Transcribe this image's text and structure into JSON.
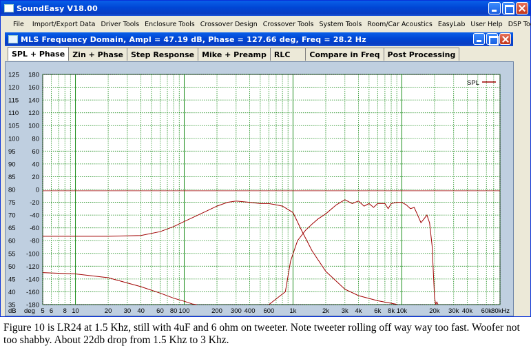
{
  "window": {
    "title": "SoundEasy V18.00"
  },
  "menu": [
    "File",
    "Import/Export Data",
    "Driver Tools",
    "Enclosure Tools",
    "Crossover Design",
    "Crossover Tools",
    "System Tools",
    "Room/Car Acoustics",
    "EasyLab",
    "User Help",
    "DSP Tools"
  ],
  "subwindow": {
    "title": "MLS Frequency Domain, Ampl = 47.19 dB, Phase = 127.66 deg, Freq = 28.2 Hz"
  },
  "tabs": [
    {
      "label": "SPL + Phase",
      "active": true
    },
    {
      "label": "Zin + Phase",
      "active": false
    },
    {
      "label": "Step Response",
      "active": false
    },
    {
      "label": "Mike + Preamp",
      "active": false
    },
    {
      "label": "RLC",
      "active": false
    },
    {
      "label": "Compare in Freq",
      "active": false
    },
    {
      "label": "Post Processing",
      "active": false
    }
  ],
  "chart_data": {
    "type": "line",
    "x_scale": "log",
    "xlim": [
      5,
      80000
    ],
    "x_ticks": [
      {
        "v": 5,
        "label": "5"
      },
      {
        "v": 6,
        "label": "6"
      },
      {
        "v": 8,
        "label": "8"
      },
      {
        "v": 10,
        "label": "10"
      },
      {
        "v": 20,
        "label": "20"
      },
      {
        "v": 30,
        "label": "30"
      },
      {
        "v": 40,
        "label": "40"
      },
      {
        "v": 60,
        "label": "60"
      },
      {
        "v": 80,
        "label": "80"
      },
      {
        "v": 100,
        "label": "100"
      },
      {
        "v": 200,
        "label": "200"
      },
      {
        "v": 300,
        "label": "300"
      },
      {
        "v": 400,
        "label": "400"
      },
      {
        "v": 600,
        "label": "600"
      },
      {
        "v": 1000,
        "label": "1k"
      },
      {
        "v": 2000,
        "label": "2k"
      },
      {
        "v": 3000,
        "label": "3k"
      },
      {
        "v": 4000,
        "label": "4k"
      },
      {
        "v": 6000,
        "label": "6k"
      },
      {
        "v": 8000,
        "label": "8k"
      },
      {
        "v": 10000,
        "label": "10k"
      },
      {
        "v": 20000,
        "label": "20k"
      },
      {
        "v": 30000,
        "label": "30k"
      },
      {
        "v": 40000,
        "label": "40k"
      },
      {
        "v": 60000,
        "label": "60k"
      },
      {
        "v": 80000,
        "label": "80kHz"
      }
    ],
    "x_unit_labels": [
      "dB",
      "deg"
    ],
    "ylim": [
      35,
      125
    ],
    "y_ticks": [
      125,
      120,
      115,
      110,
      105,
      100,
      95,
      90,
      85,
      80,
      75,
      70,
      65,
      60,
      55,
      50,
      45,
      40,
      35
    ],
    "y2_ticks": [
      180,
      160,
      140,
      120,
      100,
      80,
      60,
      40,
      20,
      0,
      -20,
      -40,
      -60,
      -80,
      -100,
      -120,
      -140,
      -160,
      -180
    ],
    "reference_line_y": 79.5,
    "legend": {
      "label": "SPL",
      "placement": "top-right"
    },
    "line_color": "#a00000",
    "series": [
      {
        "points": [
          [
            5,
            61.7
          ],
          [
            20,
            61.7
          ],
          [
            40,
            62
          ],
          [
            60,
            63.5
          ],
          [
            80,
            65.5
          ],
          [
            100,
            67.5
          ],
          [
            150,
            71
          ],
          [
            200,
            73.5
          ],
          [
            250,
            75
          ],
          [
            300,
            75.5
          ],
          [
            400,
            75
          ],
          [
            500,
            74.5
          ],
          [
            600,
            74.5
          ],
          [
            700,
            74
          ],
          [
            800,
            73.5
          ],
          [
            1000,
            71
          ],
          [
            1200,
            64
          ],
          [
            1500,
            56
          ],
          [
            2000,
            48
          ],
          [
            3000,
            41
          ],
          [
            4000,
            38.5
          ],
          [
            6000,
            36.5
          ],
          [
            8000,
            35.5
          ],
          [
            9000,
            35.1
          ]
        ]
      },
      {
        "points": [
          [
            600,
            35
          ],
          [
            850,
            40
          ],
          [
            950,
            52
          ],
          [
            1100,
            60
          ],
          [
            1300,
            64
          ],
          [
            1500,
            66.5
          ],
          [
            1700,
            68.5
          ],
          [
            2000,
            70.5
          ],
          [
            2500,
            74
          ],
          [
            3000,
            76
          ],
          [
            3500,
            74.5
          ],
          [
            4000,
            75.5
          ],
          [
            4500,
            73.5
          ],
          [
            5000,
            74.5
          ],
          [
            5500,
            73
          ],
          [
            6000,
            74.5
          ],
          [
            7000,
            74.5
          ],
          [
            7500,
            72.5
          ],
          [
            8000,
            74.5
          ],
          [
            9000,
            75
          ],
          [
            10000,
            75
          ],
          [
            11000,
            74
          ],
          [
            12000,
            72.5
          ],
          [
            13000,
            73
          ],
          [
            14000,
            70
          ],
          [
            15000,
            67
          ],
          [
            16000,
            68.5
          ],
          [
            17000,
            70
          ],
          [
            18000,
            67
          ],
          [
            19000,
            58
          ],
          [
            20000,
            38
          ],
          [
            20500,
            35
          ]
        ]
      },
      {
        "points": [
          [
            5,
            47.5
          ],
          [
            10,
            47
          ],
          [
            20,
            45.5
          ],
          [
            40,
            42
          ],
          [
            60,
            39.5
          ],
          [
            80,
            37.5
          ],
          [
            100,
            36.3
          ],
          [
            120,
            35.2
          ],
          [
            130,
            35
          ]
        ]
      },
      {
        "points": [
          [
            20500,
            35.1
          ],
          [
            21000,
            36
          ],
          [
            21500,
            35.1
          ]
        ]
      }
    ]
  },
  "caption": "Figure 10 is LR24 at 1.5 Khz, still with 4uF and 6 ohm on tweeter. Note tweeter rolling off way way too fast. Woofer not too shabby. About 22db drop from 1.5 Khz to 3 Khz."
}
